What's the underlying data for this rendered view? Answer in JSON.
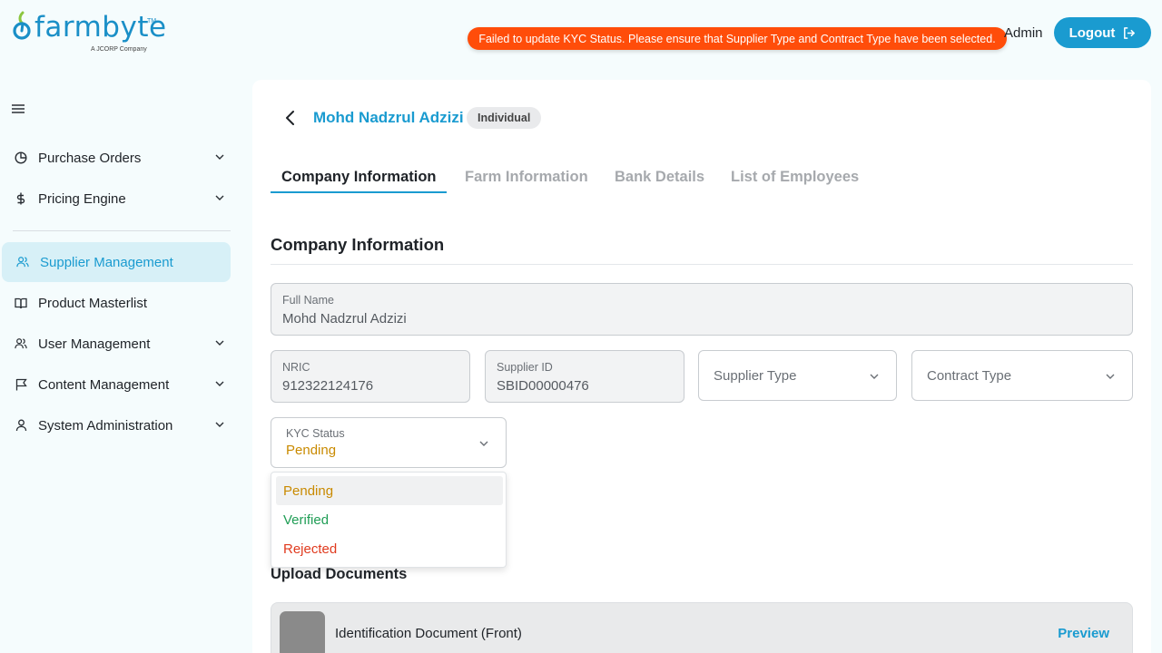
{
  "brand": {
    "name": "farmbyte",
    "trademark": "TM",
    "tagline": "A JCORP Company",
    "color": "#1a8fc7"
  },
  "toast": {
    "message": "Failed to update KYC Status. Please ensure that Supplier Type and Contract Type have been selected.",
    "color": "#ff4d0a"
  },
  "header": {
    "user_label": "Admin",
    "logout_label": "Logout"
  },
  "sidebar": {
    "items": [
      {
        "label": "Purchase Orders",
        "icon": "pie-chart-icon",
        "has_submenu": true
      },
      {
        "label": "Pricing Engine",
        "icon": "dollar-icon",
        "has_submenu": true
      },
      {
        "label": "Supplier Management",
        "icon": "users-icon",
        "has_submenu": false,
        "active": true
      },
      {
        "label": "Product Masterlist",
        "icon": "book-icon",
        "has_submenu": false
      },
      {
        "label": "User Management",
        "icon": "users-icon",
        "has_submenu": true
      },
      {
        "label": "Content Management",
        "icon": "flag-icon",
        "has_submenu": true
      },
      {
        "label": "System Administration",
        "icon": "user-icon",
        "has_submenu": true
      }
    ]
  },
  "supplier": {
    "name": "Mohd Nadzrul Adzizi",
    "type_badge": "Individual"
  },
  "tabs": [
    {
      "label": "Company Information",
      "active": true
    },
    {
      "label": "Farm Information",
      "active": false
    },
    {
      "label": "Bank Details",
      "active": false
    },
    {
      "label": "List of Employees",
      "active": false
    }
  ],
  "section": {
    "title": "Company Information"
  },
  "fields": {
    "full_name": {
      "label": "Full Name",
      "value": "Mohd Nadzrul Adzizi"
    },
    "nric": {
      "label": "NRIC",
      "value": "912322124176"
    },
    "supplier_id": {
      "label": "Supplier ID",
      "value": "SBID00000476"
    },
    "supplier_type": {
      "placeholder": "Supplier Type"
    },
    "contract_type": {
      "placeholder": "Contract Type"
    },
    "kyc_status": {
      "label": "KYC Status",
      "value": "Pending"
    }
  },
  "kyc_options": [
    {
      "label": "Pending",
      "color": "#c98a00",
      "highlighted": true
    },
    {
      "label": "Verified",
      "color": "#1f9d55",
      "highlighted": false
    },
    {
      "label": "Rejected",
      "color": "#e03a1e",
      "highlighted": false
    }
  ],
  "upload": {
    "title": "Upload Documents",
    "documents": [
      {
        "name": "Identification Document (Front)",
        "action": "Preview"
      }
    ]
  },
  "accent_color": "#1a9bd0"
}
